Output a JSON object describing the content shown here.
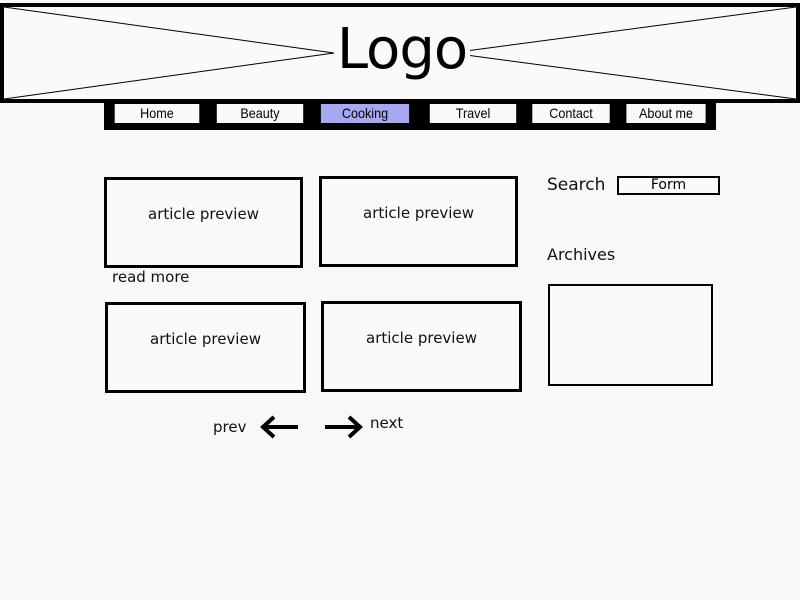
{
  "header": {
    "logo_text": "Logo"
  },
  "nav": {
    "items": [
      {
        "label": "Home",
        "active": false
      },
      {
        "label": "Beauty",
        "active": false
      },
      {
        "label": "Cooking",
        "active": true
      },
      {
        "label": "Travel",
        "active": false
      },
      {
        "label": "Contact",
        "active": false
      },
      {
        "label": "About me",
        "active": false
      }
    ],
    "active_color": "#a8a8f0"
  },
  "articles": [
    {
      "label": "article preview"
    },
    {
      "label": "article preview"
    },
    {
      "label": "article preview"
    },
    {
      "label": "article preview"
    }
  ],
  "read_more": "read more",
  "pager": {
    "prev_label": "prev",
    "prev_icon": "arrow-left-icon",
    "next_label": "next",
    "next_icon": "arrow-right-icon"
  },
  "sidebar": {
    "search_label": "Search",
    "search_form_label": "Form",
    "archives_label": "Archives"
  }
}
